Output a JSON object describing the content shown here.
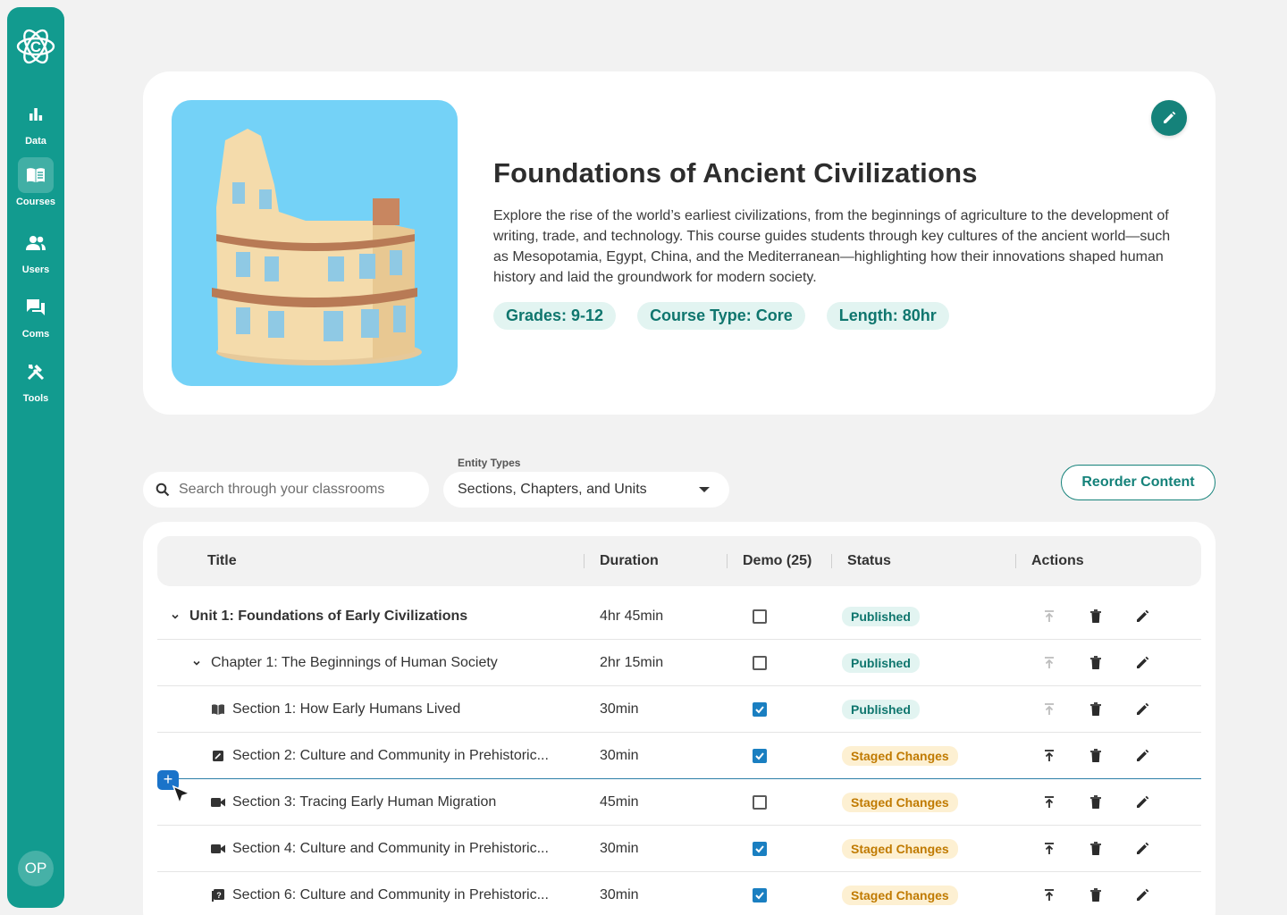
{
  "sidebar": {
    "items": [
      {
        "label": "Data",
        "icon": "bar-chart-icon"
      },
      {
        "label": "Courses",
        "icon": "book-icon",
        "active": true
      },
      {
        "label": "Users",
        "icon": "users-icon"
      },
      {
        "label": "Coms",
        "icon": "chat-icon"
      },
      {
        "label": "Tools",
        "icon": "tools-icon"
      }
    ],
    "avatar": "OP"
  },
  "course": {
    "title": "Foundations of Ancient Civilizations",
    "description": "Explore the rise of the world’s earliest civilizations, from the beginnings of agriculture to the development of writing, trade, and technology. This course guides students through key cultures of the ancient world—such as Mesopotamia, Egypt, China, and the Mediterranean—highlighting how their innovations shaped human history and laid the groundwork for modern society.",
    "chips": [
      "Grades: 9-12",
      "Course Type: Core",
      "Length: 80hr"
    ]
  },
  "controls": {
    "search_placeholder": "Search through your classrooms",
    "filter_label": "Entity Types",
    "filter_value": "Sections, Chapters, and Units",
    "reorder_label": "Reorder Content"
  },
  "table": {
    "headers": {
      "title": "Title",
      "duration": "Duration",
      "demo": "Demo (25)",
      "status": "Status",
      "actions": "Actions"
    },
    "rows": [
      {
        "title": "Unit 1: Foundations of Early Civilizations",
        "level": "unit",
        "duration": "4hr 45min",
        "demo": false,
        "status": "Published"
      },
      {
        "title": "Chapter 1: The Beginnings of Human Society",
        "level": "chapter",
        "duration": "2hr 15min",
        "demo": false,
        "status": "Published"
      },
      {
        "title": "Section 1: How Early Humans Lived",
        "level": "section",
        "icon": "book-open-icon",
        "duration": "30min",
        "demo": true,
        "status": "Published"
      },
      {
        "title": "Section 2: Culture and Community in Prehistoric...",
        "level": "section",
        "icon": "assignment-icon",
        "duration": "30min",
        "demo": true,
        "status": "Staged Changes"
      },
      {
        "title": "Section 3: Tracing Early Human Migration",
        "level": "section",
        "icon": "video-icon",
        "duration": "45min",
        "demo": false,
        "status": "Staged Changes"
      },
      {
        "title": "Section 4: Culture and Community in Prehistoric...",
        "level": "section",
        "icon": "video-icon",
        "duration": "30min",
        "demo": true,
        "status": "Staged Changes"
      },
      {
        "title": "Section 6: Culture and Community in Prehistoric...",
        "level": "section",
        "icon": "quiz-icon",
        "duration": "30min",
        "demo": true,
        "status": "Staged Changes"
      }
    ]
  },
  "colors": {
    "brand": "#129b8f",
    "brand_dark": "#15827a",
    "checkbox": "#1a7fc1",
    "staged": "#c07a00"
  }
}
